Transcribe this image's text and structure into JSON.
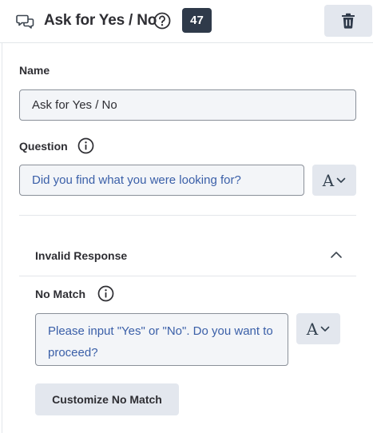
{
  "header": {
    "title": "Ask for Yes / No",
    "count": "47",
    "icons": {
      "chat": "chat-bubbles-icon",
      "help": "question-circle-icon",
      "delete": "trash-icon"
    }
  },
  "name_field": {
    "label": "Name",
    "value": "Ask for Yes / No"
  },
  "question_field": {
    "label": "Question",
    "value": "Did you find what you were looking for?",
    "format_glyph": "A"
  },
  "invalid_response": {
    "title": "Invalid Response",
    "expanded": true,
    "no_match": {
      "label": "No Match",
      "value_line1": "Please input \"Yes\" or \"No\". Do you want to",
      "value_line2": "proceed?",
      "format_glyph": "A"
    },
    "customize_button": "Customize No Match"
  },
  "colors": {
    "badge_bg": "#2f3a4a",
    "prompt_text": "#3a5fa8",
    "field_bg": "#f3f5f8",
    "button_bg": "#e3e7ee"
  }
}
